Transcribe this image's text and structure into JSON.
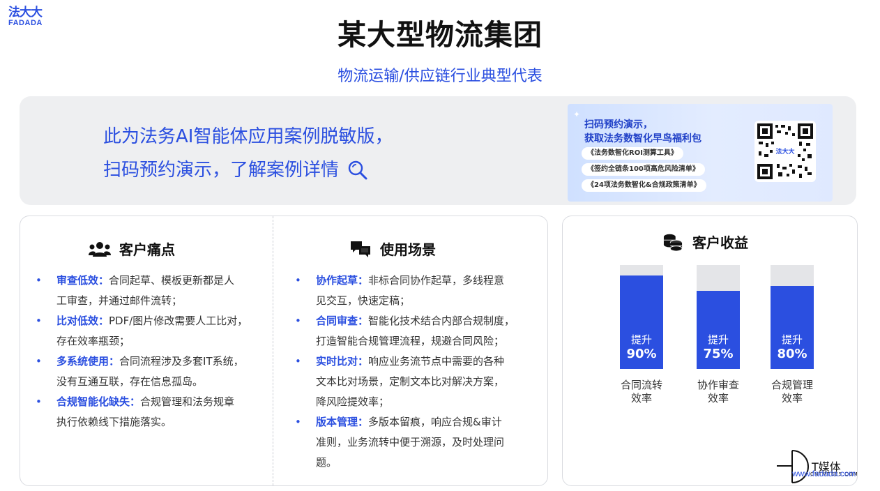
{
  "brand": {
    "logo_cn": "法大大",
    "logo_en": "FADADA"
  },
  "header": {
    "title": "某大型物流集团",
    "subtitle": "物流运输/供应链行业典型代表"
  },
  "banner": {
    "line1": "此为法务AI智能体应用案例脱敏版，",
    "line2": "扫码预约演示，了解案例详情",
    "promo": {
      "heading1": "扫码预约演示，",
      "heading2": "获取法务数智化早鸟福利包",
      "items": [
        "《法务数智化ROI测算工具》",
        "《签约全链条100项高危风险清单》",
        "《24项法务数智化&合规政策清单》"
      ],
      "qr_label": "法大大"
    }
  },
  "pain_points": {
    "title": "客户痛点",
    "items": [
      {
        "key": "审查低效：",
        "text": "合同起草、模板更新都是人",
        "text2": "工审查，并通过邮件流转；"
      },
      {
        "key": "比对低效：",
        "text": "PDF/图片修改需要人工比对，",
        "text2": "存在效率瓶颈；"
      },
      {
        "key": "多系统使用：",
        "text": "合同流程涉及多套IT系统，",
        "text2": "没有互通互联，存在信息孤岛。"
      },
      {
        "key": "合规智能化缺失：",
        "text": "合规管理和法务规章",
        "text2": "执行依赖线下措施落实。"
      }
    ]
  },
  "scenarios": {
    "title": "使用场景",
    "items": [
      {
        "key": "协作起草：",
        "text": "非标合同协作起草，多线程意",
        "text2": "见交互，快速定稿；",
        "text3": ""
      },
      {
        "key": "合同审查：",
        "text": "智能化技术结合内部合规制度，",
        "text2": "打造智能合规管理流程，规避合同风险；",
        "text3": ""
      },
      {
        "key": "实时比对：",
        "text": "响应业务流节点中需要的各种",
        "text2": "文本比对场景，定制文本比对解决方案，",
        "text3": "降风险提效率；"
      },
      {
        "key": "版本管理：",
        "text": "多版本留痕，响应合规&审计",
        "text2": "准则，业务流转中便于溯源，及时处理问",
        "text3": "题。"
      }
    ]
  },
  "benefits": {
    "title": "客户收益",
    "bars": [
      {
        "prefix": "提升",
        "value_label": "90%",
        "value": 0.9,
        "label1": "合同流转",
        "label2": "效率"
      },
      {
        "prefix": "提升",
        "value_label": "75%",
        "value": 0.75,
        "label1": "协作审查",
        "label2": "效率"
      },
      {
        "prefix": "提升",
        "value_label": "80%",
        "value": 0.8,
        "label1": "合规管理",
        "label2": "效率"
      }
    ]
  },
  "watermark": {
    "cn": "T媒体",
    "en": "CNTMTEES.COM",
    "url": "www.fadada.com"
  },
  "colors": {
    "accent": "#2b4fe0",
    "track": "#e4e5e8",
    "banner_bg": "#eeeff1"
  }
}
